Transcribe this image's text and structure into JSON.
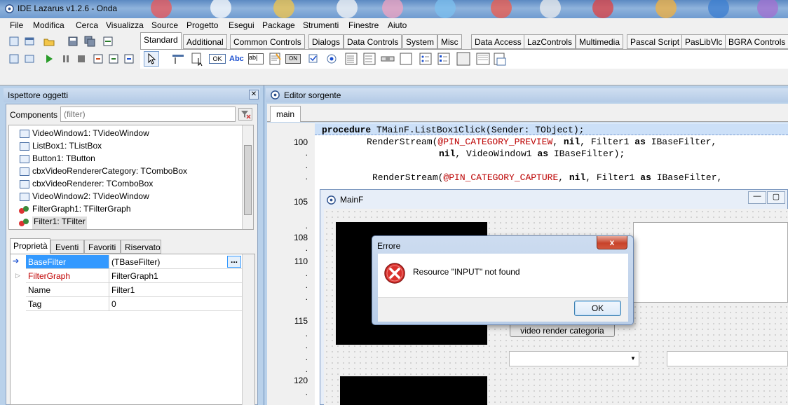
{
  "window": {
    "title": "IDE Lazarus v1.2.6 - Onda"
  },
  "menu": [
    "File",
    "Modifica",
    "Cerca",
    "Visualizza",
    "Source",
    "Progetto",
    "Esegui",
    "Package",
    "Strumenti",
    "Finestre",
    "Aiuto"
  ],
  "palette_tabs": [
    "Standard",
    "Additional",
    "Common Controls",
    "Dialogs",
    "Data Controls",
    "System",
    "Misc",
    "Data Access",
    "LazControls",
    "Multimedia",
    "Pascal Script",
    "PasLibVlc",
    "BGRA Controls"
  ],
  "palette_icon_labels": {
    "ok": "OK",
    "abc": "Abc",
    "abl": "ab|",
    "on": "ON"
  },
  "inspector": {
    "title": "Ispettore oggetti",
    "components_label": "Components",
    "filter_placeholder": "(filter)",
    "tree": [
      "VideoWindow1: TVideoWindow",
      "ListBox1: TListBox",
      "Button1: TButton",
      "cbxVideoRendererCategory: TComboBox",
      "cbxVideoRenderer: TComboBox",
      "VideoWindow2: TVideoWindow",
      "FilterGraph1: TFilterGraph",
      "Filter1: TFilter"
    ],
    "tabs": [
      "Proprietà",
      "Eventi",
      "Favoriti",
      "Riservato"
    ],
    "props": [
      {
        "name": "BaseFilter",
        "value": "(TBaseFilter)"
      },
      {
        "name": "FilterGraph",
        "value": "FilterGraph1"
      },
      {
        "name": "Name",
        "value": "Filter1"
      },
      {
        "name": "Tag",
        "value": "0"
      }
    ],
    "ellipsis": "..."
  },
  "editor": {
    "title": "Editor sorgente",
    "tab": "main",
    "line_numbers": [
      "100",
      "105",
      "108",
      "110",
      "115",
      "120"
    ],
    "dot": ".",
    "code": {
      "l1_kw": "procedure",
      "l1_rest": " TMainF.ListBox1Click(Sender: TObject);",
      "l2_a": "RenderStream(",
      "l2_b": "@PIN_CATEGORY_PREVIEW",
      "l2_c": ", ",
      "l2_d": "nil",
      "l2_e": ", Filter1 ",
      "l2_f": "as",
      "l2_g": " IBaseFilter,",
      "l3_a": "nil",
      "l3_b": ", VideoWindow1 ",
      "l3_c": "as",
      "l3_d": " IBaseFilter);",
      "l4_a": "RenderStream(",
      "l4_b": "@PIN_CATEGORY_CAPTURE",
      "l4_c": ", ",
      "l4_d": "nil",
      "l4_e": ", Filter1 ",
      "l4_f": "as",
      "l4_g": " IBaseFilter,"
    }
  },
  "form": {
    "title": "MainF",
    "button": "video render categoria"
  },
  "dialog": {
    "title": "Errore",
    "message": "Resource \"INPUT\" not found",
    "ok": "OK",
    "close": "x"
  },
  "colors": {
    "accent": "#3399ff",
    "title_blue": "#b9d1ea",
    "error_red": "#d9302c",
    "selection": "#cce0f8"
  }
}
